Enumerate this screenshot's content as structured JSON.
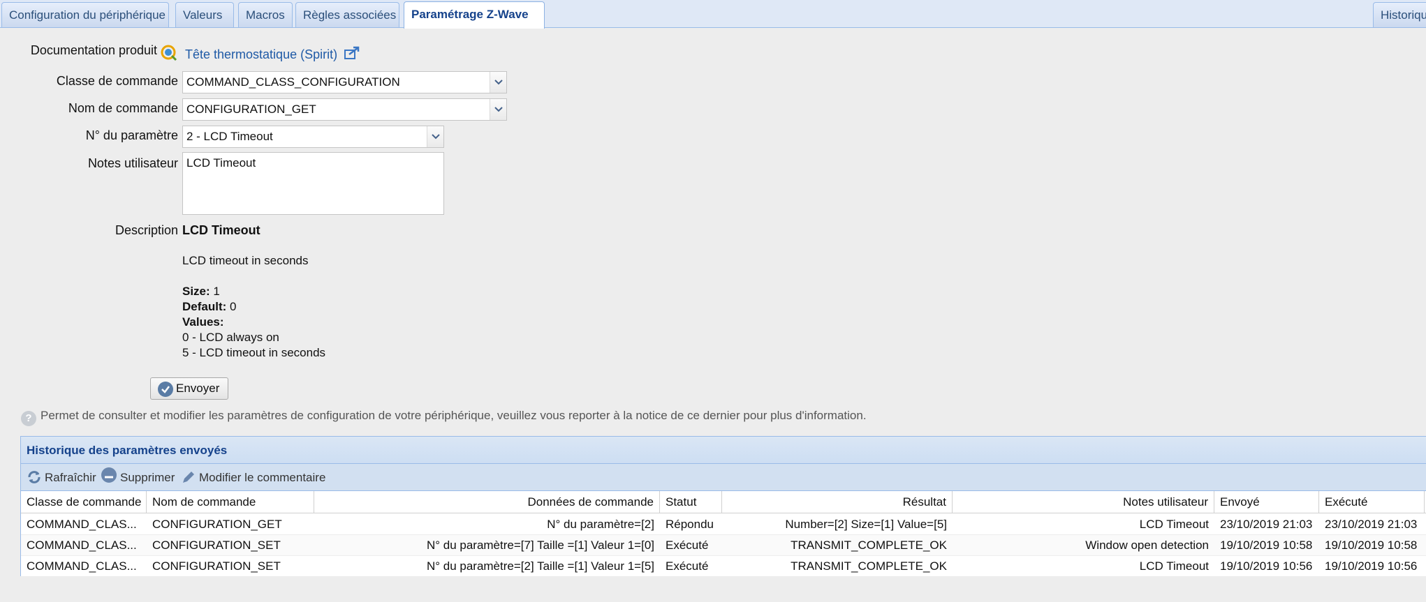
{
  "tabs": [
    {
      "label": "Configuration du périphérique"
    },
    {
      "label": "Valeurs"
    },
    {
      "label": "Macros"
    },
    {
      "label": "Règles associées"
    },
    {
      "label": "Paramétrage Z-Wave"
    },
    {
      "label": "Historiqu"
    }
  ],
  "form": {
    "doc_label": "Documentation produit",
    "doc_link": "Tête thermostatique (Spirit)",
    "class_label": "Classe de commande",
    "class_value": "COMMAND_CLASS_CONFIGURATION",
    "cmd_label": "Nom de commande",
    "cmd_value": "CONFIGURATION_GET",
    "param_label": "N° du paramètre",
    "param_value": "2 - LCD Timeout",
    "notes_label": "Notes utilisateur",
    "notes_value": "LCD Timeout",
    "desc_label": "Description",
    "desc_title": "LCD Timeout",
    "desc_text": "LCD timeout in seconds",
    "size_label": "Size:",
    "size_value": "1",
    "default_label": "Default:",
    "default_value": "0",
    "values_label": "Values:",
    "value_0": "0 - LCD always on",
    "value_5": "5 - LCD timeout in seconds",
    "send_label": "Envoyer"
  },
  "hint": "Permet de consulter et modifier les paramètres de configuration de votre périphérique, veuillez vous reporter à la notice de ce dernier pour plus d'information.",
  "history": {
    "title": "Historique des paramètres envoyés",
    "toolbar": {
      "refresh": "Rafraîchir",
      "delete": "Supprimer",
      "edit": "Modifier le commentaire"
    },
    "columns": [
      "Classe de commande",
      "Nom de commande",
      "Données de commande",
      "Statut",
      "Résultat",
      "Notes utilisateur",
      "Envoyé",
      "Exécuté"
    ],
    "rows": [
      [
        "COMMAND_CLAS...",
        "CONFIGURATION_GET",
        "N° du paramètre=[2]",
        "Répondu",
        "Number=[2] Size=[1] Value=[5]",
        "LCD Timeout",
        "23/10/2019 21:03",
        "23/10/2019 21:03"
      ],
      [
        "COMMAND_CLAS...",
        "CONFIGURATION_SET",
        "N° du paramètre=[7] Taille =[1] Valeur 1=[0]",
        "Exécuté",
        "TRANSMIT_COMPLETE_OK",
        "Window open detection",
        "19/10/2019 10:58",
        "19/10/2019 10:58"
      ],
      [
        "COMMAND_CLAS...",
        "CONFIGURATION_SET",
        "N° du paramètre=[2] Taille =[1] Valeur 1=[5]",
        "Exécuté",
        "TRANSMIT_COMPLETE_OK",
        "LCD Timeout",
        "19/10/2019 10:56",
        "19/10/2019 10:56"
      ]
    ]
  },
  "colors": {
    "accent": "#15428b",
    "header_bg": "#cddef3",
    "link": "#1f5aa6"
  }
}
